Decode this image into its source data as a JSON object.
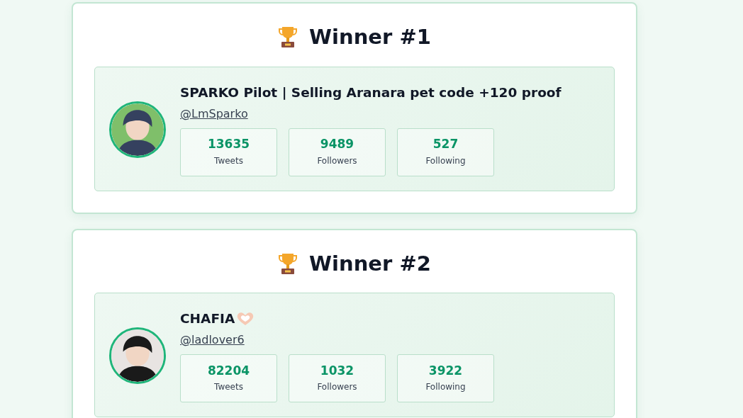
{
  "winners": [
    {
      "title": "Winner #1",
      "name": "SPARKO Pilot | Selling Aranara pet code +120 proof",
      "heart_hands": false,
      "handle": "@LmSparko",
      "stats": [
        {
          "value": "13635",
          "label": "Tweets"
        },
        {
          "value": "9489",
          "label": "Followers"
        },
        {
          "value": "527",
          "label": "Following"
        }
      ]
    },
    {
      "title": "Winner #2",
      "name": "CHAFIA",
      "heart_hands": true,
      "handle": "@ladlover6",
      "stats": [
        {
          "value": "82204",
          "label": "Tweets"
        },
        {
          "value": "1032",
          "label": "Followers"
        },
        {
          "value": "3922",
          "label": "Following"
        }
      ]
    }
  ]
}
